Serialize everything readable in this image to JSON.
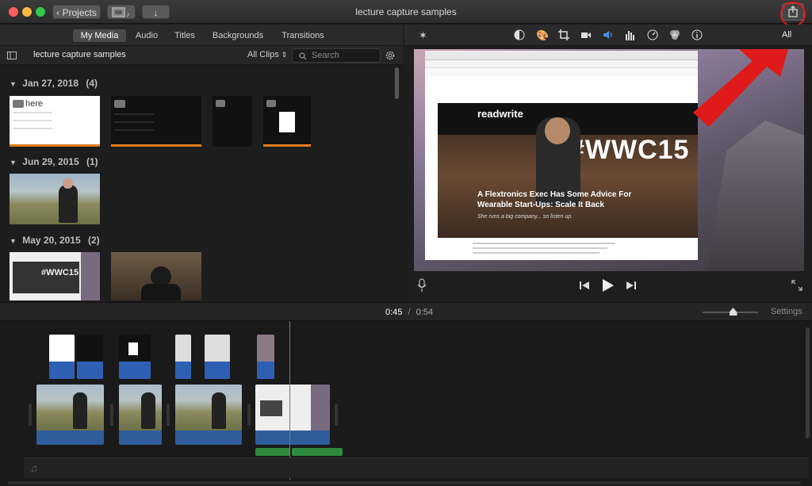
{
  "window": {
    "title": "lecture capture samples",
    "back_label": "Projects"
  },
  "browser": {
    "tabs": [
      {
        "label": "My Media",
        "active": true
      },
      {
        "label": "Audio",
        "active": false
      },
      {
        "label": "Titles",
        "active": false
      },
      {
        "label": "Backgrounds",
        "active": false
      },
      {
        "label": "Transitions",
        "active": false
      }
    ],
    "event_title": "lecture capture samples",
    "filter_label": "All Clips",
    "search_placeholder": "Search",
    "groups": [
      {
        "date": "Jan 27, 2018",
        "count": "(4)"
      },
      {
        "date": "Jun 29, 2015",
        "count": "(1)"
      },
      {
        "date": "May 20, 2015",
        "count": "(2)"
      }
    ],
    "thumb_here_text": "here"
  },
  "viewer": {
    "reset_all": "All",
    "article": {
      "brand": "readwrite",
      "hashtag": "#WWC15",
      "headline_line1": "A Flextronics Exec Has Some Advice For",
      "headline_line2": "Wearable Start-Ups: Scale It Back",
      "subhead": "She runs a big company... so listen up."
    }
  },
  "timeline": {
    "current_time": "0:45",
    "separator": "/",
    "total_time": "0:54",
    "settings_label": "Settings",
    "zoom_level": 0.55
  },
  "colors": {
    "accent_blue": "#2f63b8",
    "highlight_red": "#e01a1a",
    "audio_blue": "#2f5d9c",
    "audio_green": "#2e8b3e"
  }
}
